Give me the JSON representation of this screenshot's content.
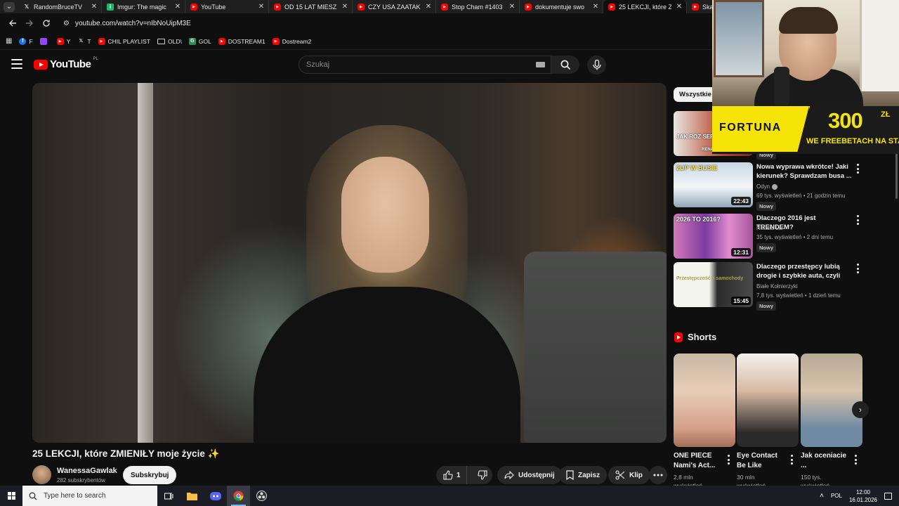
{
  "browser": {
    "tabs": [
      {
        "title": "RandomBruceTV",
        "icon": "x",
        "active": false
      },
      {
        "title": "Imgur: The magic",
        "icon": "imgur",
        "active": false
      },
      {
        "title": "YouTube",
        "icon": "youtube",
        "active": false
      },
      {
        "title": "OD 15 LAT MIESZ",
        "icon": "youtube",
        "active": false
      },
      {
        "title": "CZY USA ZAATAK",
        "icon": "youtube",
        "active": false
      },
      {
        "title": "Stop Cham #1403",
        "icon": "youtube",
        "active": false
      },
      {
        "title": "dokumentuje swo",
        "icon": "youtube",
        "active": false
      },
      {
        "title": "25 LEKCJI, które Z",
        "icon": "youtube",
        "active": true
      },
      {
        "title": "Skarżyła się na bó",
        "icon": "youtube",
        "active": false
      }
    ],
    "url": "youtube.com/watch?v=nIbNoUipM3E",
    "bookmarks": [
      {
        "label": "F",
        "icon": "facebook"
      },
      {
        "label": "",
        "icon": "twitch"
      },
      {
        "label": "Y",
        "icon": "youtube"
      },
      {
        "label": "T",
        "icon": "x"
      },
      {
        "label": "CHIL PLAYLIST",
        "icon": "youtube"
      },
      {
        "label": "OLD\\",
        "icon": "folder"
      },
      {
        "label": "GOL",
        "icon": "gol"
      },
      {
        "label": "DOSTREAM1",
        "icon": "youtube"
      },
      {
        "label": "Dostream2",
        "icon": "youtube"
      }
    ]
  },
  "youtube": {
    "logo_text": "YouTube",
    "country": "PL",
    "search_placeholder": "Szukaj"
  },
  "video": {
    "title": "25 LEKCJI, które ZMIENIŁY moje życie ✨",
    "channel": "WanessaGawlak",
    "subscribers": "282 subskrybentów",
    "subscribe_label": "Subskrybuj",
    "likes": "1",
    "share_label": "Udostępnij",
    "save_label": "Zapisz",
    "clip_label": "Klip"
  },
  "sidebar": {
    "chip": "Wszystkie",
    "recommendations": [
      {
        "thumb_text": "JAK ROZ SERYJNEGO",
        "caption": "RENATA",
        "title": "",
        "channel": "",
        "meta": "",
        "badge": "Nowy",
        "duration": ""
      },
      {
        "thumb_text": "2UP W BUSIE",
        "title": "Nowa wyprawa wkrótce! Jaki kierunek? Sprawdzam busa ...",
        "channel": "Odyn",
        "meta": "69 tys. wyświetleń • 21 godzin temu",
        "badge": "Nowy",
        "duration": "22:43"
      },
      {
        "thumb_text": "2026 TO 2016?",
        "title": "Dlaczego 2016 jest TRENDEM?",
        "channel": "Natalia Lis",
        "meta": "35 tys. wyświetleń • 2 dni temu",
        "badge": "Nowy",
        "duration": "12:31"
      },
      {
        "thumb_text": "Przestępczość a samochody",
        "title": "Dlaczego przestępcy lubią drogie i szybkie auta, czyli BM...",
        "channel": "Białe Kołnierzyki",
        "meta": "7,8 tys. wyświetleń • 1 dzień temu",
        "badge": "Nowy",
        "duration": "15:45"
      }
    ],
    "shorts_title": "Shorts",
    "shorts": [
      {
        "title": "ONE PIECE Nami's Act...",
        "views": "2,8 mln",
        "views2": "wyświetleń"
      },
      {
        "title": "Eye Contact Be Like",
        "views": "30 mln",
        "views2": "wyświetleń"
      },
      {
        "title": "Jak oceniacie ...",
        "views": "150 tys.",
        "views2": "wyświetleń"
      }
    ]
  },
  "ad": {
    "brand": "FORTUNA",
    "amount": "300",
    "currency": "ZŁ",
    "tagline": "WE FREEBETACH NA STAR"
  },
  "taskbar": {
    "search_placeholder": "Type here to search",
    "language": "POL",
    "time": "12:00",
    "date": "16.01.2026"
  }
}
